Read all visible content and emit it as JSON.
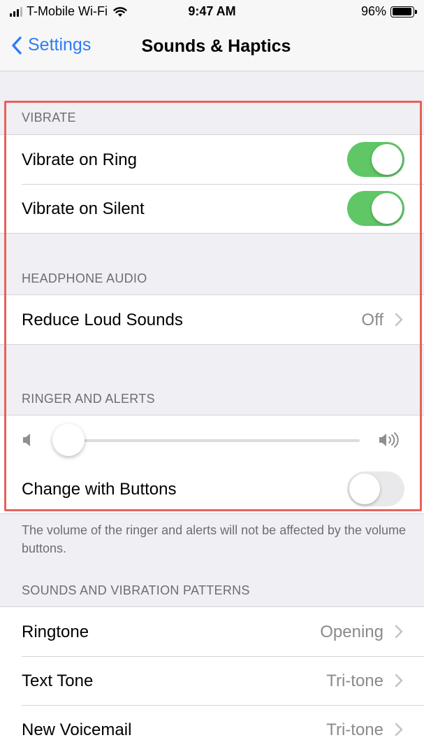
{
  "status_bar": {
    "carrier": "T-Mobile Wi-Fi",
    "time": "9:47 AM",
    "battery": "96%"
  },
  "nav": {
    "back_label": "Settings",
    "title": "Sounds & Haptics"
  },
  "vibrate": {
    "header": "VIBRATE",
    "rows": [
      {
        "label": "Vibrate on Ring",
        "toggle": "on"
      },
      {
        "label": "Vibrate on Silent",
        "toggle": "on"
      }
    ]
  },
  "headphone_audio": {
    "header": "HEADPHONE AUDIO",
    "rows": [
      {
        "label": "Reduce Loud Sounds",
        "value": "Off"
      }
    ]
  },
  "ringer_alerts": {
    "header": "RINGER AND ALERTS",
    "volume_level": 0.0,
    "change_with_buttons": {
      "label": "Change with Buttons",
      "toggle": "off"
    },
    "footer": "The volume of the ringer and alerts will not be affected by the volume buttons."
  },
  "patterns": {
    "header": "SOUNDS AND VIBRATION PATTERNS",
    "rows": [
      {
        "label": "Ringtone",
        "value": "Opening"
      },
      {
        "label": "Text Tone",
        "value": "Tri-tone"
      },
      {
        "label": "New Voicemail",
        "value": "Tri-tone"
      }
    ]
  },
  "colors": {
    "accent": "#2e7cf6",
    "toggle_on": "#5fc766",
    "highlight": "#e4625a"
  }
}
